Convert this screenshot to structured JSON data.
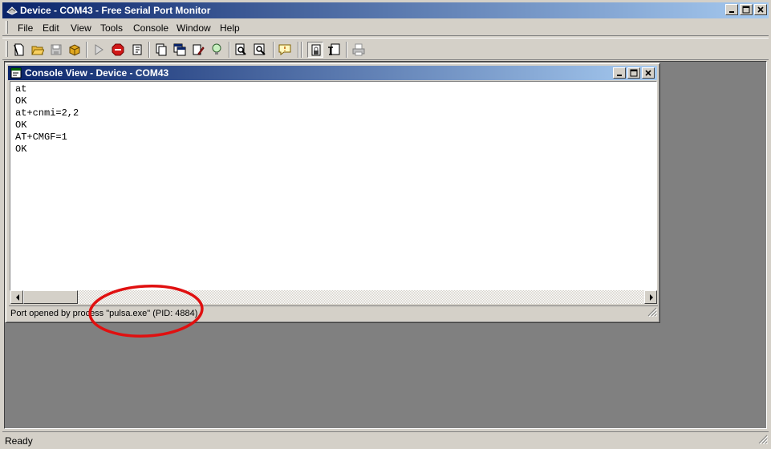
{
  "window": {
    "title": "Device - COM43 - Free Serial Port Monitor"
  },
  "menu": {
    "items": [
      "File",
      "Edit",
      "View",
      "Tools",
      "Console",
      "Window",
      "Help"
    ]
  },
  "toolbar": {
    "buttons": [
      "new-session-icon",
      "open-folder-icon",
      "save-icon",
      "package-icon",
      "play-icon",
      "stop-icon",
      "export-icon",
      "copy-icon",
      "copy-window-icon",
      "edit-icon",
      "lightbulb-icon",
      "find-icon",
      "find-next-icon",
      "comment-icon",
      "lock-doc-icon",
      "text-view-icon",
      "print-icon"
    ]
  },
  "console_window": {
    "title": "Console View - Device - COM43",
    "lines": [
      "at",
      "OK",
      "at+cnmi=2,2",
      "OK",
      "AT+CMGF=1",
      "OK"
    ],
    "status": "Port opened by process \"pulsa.exe\" (PID: 4884)"
  },
  "statusbar": {
    "text": "Ready"
  },
  "colors": {
    "title_active_start": "#0a246a",
    "title_active_end": "#a6caf0",
    "face": "#d4d0c8",
    "mdi_background": "#808080",
    "annotation": "#e01010"
  }
}
